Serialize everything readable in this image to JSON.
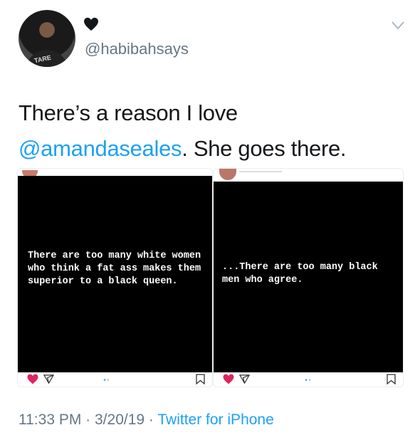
{
  "tweet": {
    "handle": "@habibahsays",
    "text_mention": "@amandaseales",
    "text_pre": "There’s a reason I love",
    "text_post": ". She goes there.",
    "avatar_shirt_text": "TARE"
  },
  "images": [
    {
      "caption": "There are too many white women who think a fat ass makes them superior to a black queen."
    },
    {
      "caption": "...There are too many black men who agree."
    }
  ],
  "meta": {
    "time": "11:33 PM",
    "sep1": " · ",
    "date": "3/20/19",
    "sep2": " · ",
    "source": "Twitter for iPhone"
  },
  "colors": {
    "link": "#1da1f2",
    "muted": "#657786",
    "heart": "#e0245e"
  }
}
